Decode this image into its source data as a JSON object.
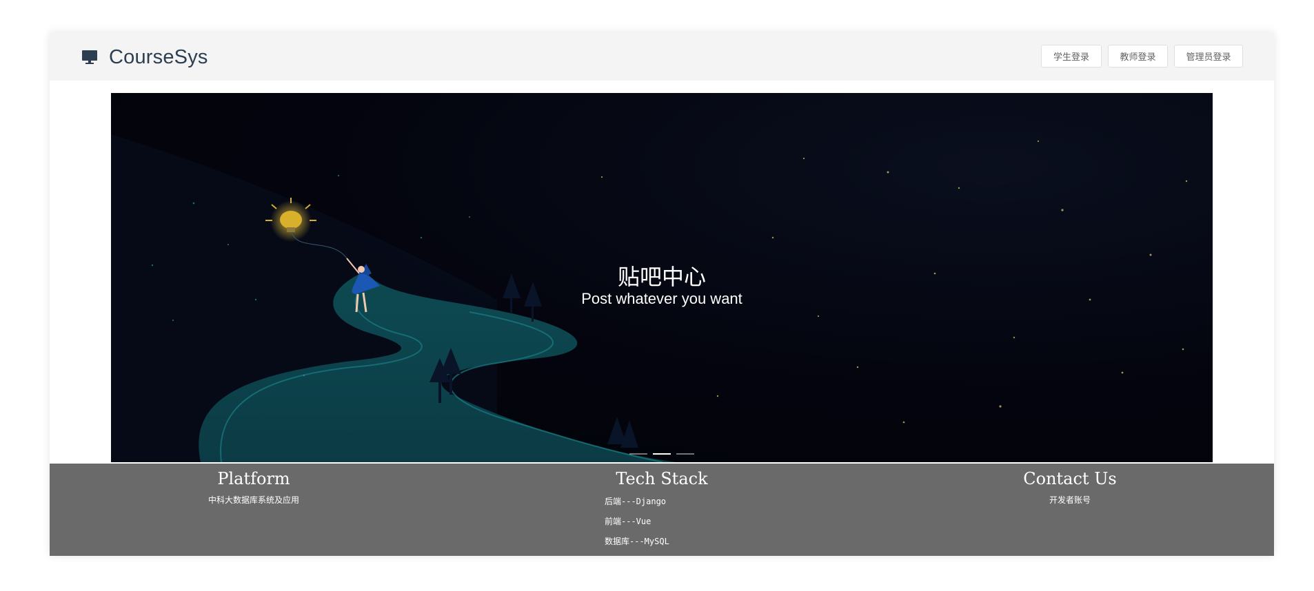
{
  "header": {
    "brand": "CourseSys",
    "brand_icon": "monitor-icon",
    "buttons": {
      "student_login": "学生登录",
      "teacher_login": "教师登录",
      "admin_login": "管理员登录"
    }
  },
  "carousel": {
    "title": "贴吧中心",
    "subtitle": "Post whatever you want",
    "indicator_count": 3,
    "active_index": 1
  },
  "footer": {
    "platform": {
      "heading": "Platform",
      "text": "中科大数据库系统及应用"
    },
    "tech": {
      "heading": "Tech Stack",
      "items": [
        "后端---Django",
        "前端---Vue",
        "数据库---MySQL"
      ]
    },
    "contact": {
      "heading": "Contact Us",
      "text": "开发者账号"
    }
  },
  "colors": {
    "header_bg": "#f4f4f4",
    "footer_bg": "#6a6a6a",
    "brand_text": "#2c3e50",
    "hero_bg": "#03040d",
    "accent_teal": "#0f5e64"
  }
}
